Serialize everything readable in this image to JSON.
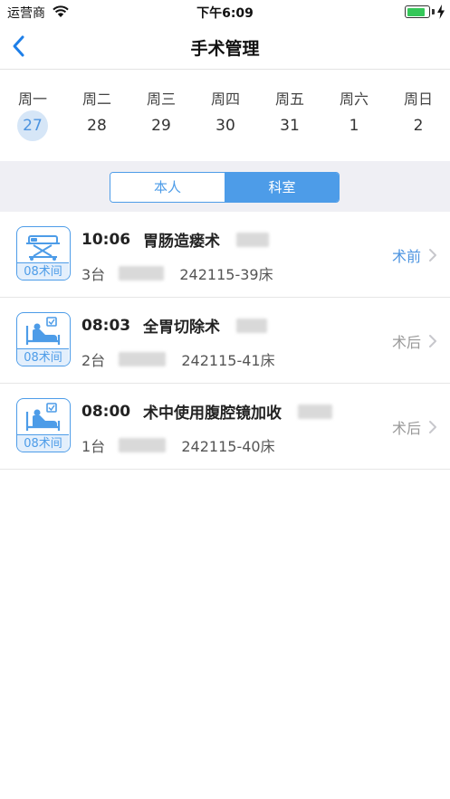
{
  "status_bar": {
    "carrier": "运营商",
    "time": "下午6:09",
    "battery_level": 0.85
  },
  "nav": {
    "title": "手术管理"
  },
  "week": {
    "days": [
      {
        "label": "周一",
        "date": "27"
      },
      {
        "label": "周二",
        "date": "28"
      },
      {
        "label": "周三",
        "date": "29"
      },
      {
        "label": "周四",
        "date": "30"
      },
      {
        "label": "周五",
        "date": "31"
      },
      {
        "label": "周六",
        "date": "1"
      },
      {
        "label": "周日",
        "date": "2"
      }
    ],
    "selected_index": 0
  },
  "segment": {
    "left_label": "本人",
    "right_label": "科室",
    "selected": "科室"
  },
  "colors": {
    "accent": "#4d9ce8",
    "selected_day_bg": "#d6e6f7",
    "status_pre": "#4d94e0",
    "status_post": "#999999"
  },
  "surgeries": [
    {
      "icon": "surgical-bed-icon",
      "room": "08术间",
      "time": "10:06",
      "procedure": "胃肠造瘘术",
      "table": "3台",
      "bed": "242115-39床",
      "status": "术前"
    },
    {
      "icon": "patient-bed-icon",
      "room": "08术间",
      "time": "08:03",
      "procedure": "全胃切除术",
      "table": "2台",
      "bed": "242115-41床",
      "status": "术后"
    },
    {
      "icon": "patient-bed-icon",
      "room": "08术间",
      "time": "08:00",
      "procedure": "术中使用腹腔镜加收",
      "table": "1台",
      "bed": "242115-40床",
      "status": "术后"
    }
  ]
}
